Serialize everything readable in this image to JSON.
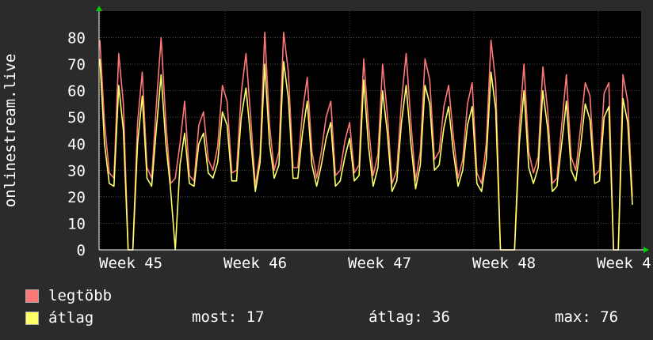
{
  "colors": {
    "background": "#2b2b2b",
    "plot": "#000000",
    "grid": "#4a4a4a",
    "max_line": "#ff7777",
    "avg_line": "#ffff66",
    "text": "#ffffff",
    "axis_arrow": "#00cc00"
  },
  "chart_data": {
    "type": "line",
    "ylabel": "onlinestream.live",
    "ylim": [
      0,
      90
    ],
    "yticks": [
      0,
      10,
      20,
      30,
      40,
      50,
      60,
      70,
      80
    ],
    "xticks": [
      "Week 45",
      "Week 46",
      "Week 47",
      "Week 48",
      "Week 4"
    ],
    "series": [
      {
        "name": "legtöbb",
        "color": "#ff7777",
        "values": [
          79,
          48,
          29,
          27,
          74,
          55,
          0,
          0,
          48,
          67,
          31,
          27,
          55,
          80,
          48,
          25,
          27,
          40,
          56,
          28,
          26,
          47,
          52,
          34,
          30,
          39,
          62,
          56,
          29,
          30,
          59,
          74,
          50,
          24,
          36,
          82,
          47,
          30,
          37,
          82,
          67,
          31,
          31,
          52,
          65,
          37,
          27,
          37,
          50,
          56,
          28,
          30,
          41,
          48,
          29,
          32,
          72,
          47,
          28,
          36,
          70,
          51,
          25,
          30,
          56,
          74,
          48,
          26,
          37,
          72,
          64,
          34,
          37,
          54,
          62,
          43,
          27,
          34,
          55,
          63,
          29,
          25,
          40,
          79,
          63,
          0,
          0,
          0,
          0,
          46,
          70,
          37,
          29,
          35,
          69,
          53,
          25,
          27,
          47,
          66,
          35,
          30,
          46,
          63,
          58,
          28,
          30,
          59,
          63,
          0,
          0,
          66,
          56,
          20
        ]
      },
      {
        "name": "átlag",
        "color": "#ffff66",
        "values": [
          72,
          40,
          25,
          24,
          62,
          45,
          0,
          0,
          40,
          58,
          27,
          24,
          46,
          66,
          40,
          23,
          0,
          32,
          44,
          25,
          24,
          40,
          44,
          29,
          27,
          33,
          52,
          47,
          26,
          26,
          50,
          61,
          42,
          22,
          33,
          70,
          40,
          27,
          32,
          71,
          57,
          27,
          27,
          44,
          56,
          32,
          24,
          32,
          42,
          48,
          24,
          26,
          35,
          42,
          26,
          28,
          64,
          39,
          24,
          31,
          60,
          44,
          22,
          26,
          48,
          62,
          40,
          23,
          32,
          62,
          55,
          30,
          32,
          46,
          54,
          37,
          24,
          30,
          47,
          54,
          25,
          22,
          34,
          67,
          53,
          0,
          0,
          0,
          0,
          40,
          60,
          31,
          25,
          31,
          60,
          46,
          22,
          24,
          40,
          56,
          30,
          26,
          39,
          55,
          49,
          25,
          26,
          50,
          54,
          0,
          0,
          57,
          48,
          17
        ]
      }
    ]
  },
  "legend": [
    {
      "label": "legtöbb",
      "color": "#ff7777"
    },
    {
      "label": "átlag",
      "color": "#ffff66"
    }
  ],
  "stats": {
    "current": "most: 17",
    "average": "átlag: 36",
    "max": "max: 76"
  }
}
